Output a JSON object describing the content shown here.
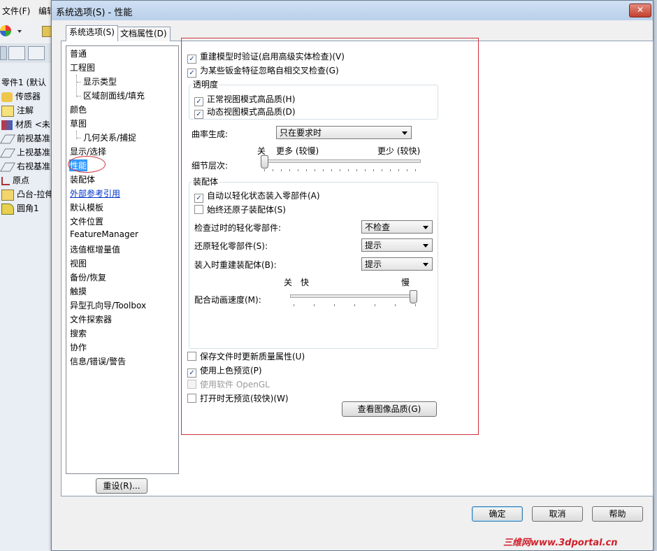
{
  "background_app": {
    "menu": [
      "文件(F)",
      "编辑"
    ],
    "tree_items": [
      {
        "label": "零件1 (默认",
        "icon": "part-icon"
      },
      {
        "label": "传感器",
        "icon": "sensor-icon"
      },
      {
        "label": "注解",
        "icon": "annotation-icon"
      },
      {
        "label": "材质 <未",
        "icon": "material-icon"
      },
      {
        "label": "前视基准",
        "icon": "plane-icon"
      },
      {
        "label": "上视基准",
        "icon": "plane-icon"
      },
      {
        "label": "右视基准",
        "icon": "plane-icon"
      },
      {
        "label": "原点",
        "icon": "origin-icon"
      },
      {
        "label": "凸台-拉伸",
        "icon": "extrude-icon"
      },
      {
        "label": "圆角1",
        "icon": "fillet-icon"
      }
    ]
  },
  "dialog": {
    "title": "系统选项(S) - 性能",
    "close_label": "✕",
    "tabs": [
      "系统选项(S)",
      "文档属性(D)"
    ],
    "nav": [
      "普通",
      "工程图",
      "显示类型",
      "区域剖面线/填充",
      "颜色",
      "草图",
      "几何关系/捕捉",
      "显示/选择",
      "性能",
      "装配体",
      "外部参考引用",
      "默认模板",
      "文件位置",
      "FeatureManager",
      "选值框增量值",
      "视图",
      "备份/恢复",
      "触摸",
      "异型孔向导/Toolbox",
      "文件探索器",
      "搜索",
      "协作",
      "信息/错误/警告"
    ],
    "reset_label": "重设(R)...",
    "options": {
      "rebuild_verify": {
        "label": "重建模型时验证(启用高级实体检查)(V)",
        "checked": true
      },
      "sheetmetal_ignore": {
        "label": "为某些钣金特征忽略自相交叉检查(G)",
        "checked": true
      },
      "transparency": {
        "legend": "透明度",
        "normal_hq": {
          "label": "正常视图模式高品质(H)",
          "checked": true
        },
        "dynamic_hq": {
          "label": "动态视图模式高品质(D)",
          "checked": true
        }
      },
      "curvature_label": "曲率生成:",
      "curvature_value": "只在要求时",
      "detail": {
        "label": "细节层次:",
        "off": "关",
        "more": "更多 (较慢)",
        "less": "更少 (较快)",
        "level": 0
      },
      "assembly": {
        "legend": "装配体",
        "auto_lightweight": {
          "label": "自动以轻化状态装入零部件(A)",
          "checked": true
        },
        "always_resolve": {
          "label": "始终还原子装配体(S)",
          "checked": false
        },
        "check_outdated_label": "检查过时的轻化零部件:",
        "check_outdated_value": "不检查",
        "resolve_lightweight_label": "还原轻化零部件(S):",
        "resolve_lightweight_value": "提示",
        "rebuild_on_load_label": "装入时重建装配体(B):",
        "rebuild_on_load_value": "提示",
        "mate_anim": {
          "label": "配合动画速度(M):",
          "off": "关",
          "fast": "快",
          "slow": "慢",
          "level": 1
        }
      },
      "update_mass": {
        "label": "保存文件时更新质量属性(U)",
        "checked": false
      },
      "shaded_preview": {
        "label": "使用上色预览(P)",
        "checked": true
      },
      "software_opengl": {
        "label": "使用软件 OpenGL",
        "checked": false,
        "disabled": true
      },
      "no_preview_open": {
        "label": "打开时无预览(较快)(W)",
        "checked": false
      },
      "image_quality_label": "查看图像品质(G)"
    },
    "buttons": {
      "ok": "确定",
      "cancel": "取消",
      "help": "帮助"
    }
  },
  "watermark": "三维网www.3dportal.cn",
  "colors": {
    "highlight": "#d0323a",
    "selection": "#3399ff",
    "link": "#0033cc"
  }
}
